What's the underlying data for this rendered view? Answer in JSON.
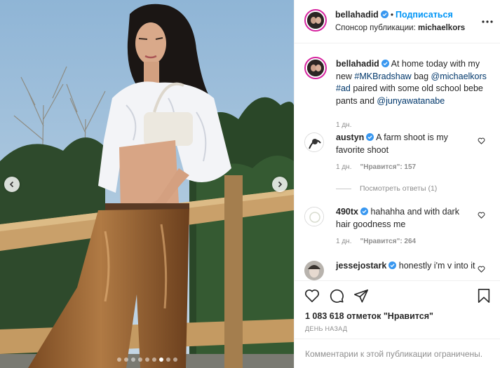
{
  "post": {
    "username": "bellahadid",
    "follow_label": "Подписаться",
    "sponsor_prefix": "Спонсор публикации:",
    "sponsor_name": "michaelkors",
    "separator": "•"
  },
  "caption": {
    "username": "bellahadid",
    "text_1": "At home today with my new",
    "link_hashtag": "#MKBradshaw",
    "text_2": "bag",
    "link_brand": "@michaelkors",
    "link_ad": "#ad",
    "text_3": "paired with some old school bebe pants and",
    "link_user": "@junyawatanabe",
    "time": "1 дн."
  },
  "comments": [
    {
      "username": "austyn",
      "text": "A farm shoot is my favorite shoot",
      "time": "1 дн.",
      "likes": "\"Нравится\": 157",
      "replies_label": "Посмотреть ответы (1)"
    },
    {
      "username": "490tx",
      "text": "hahahha and with dark hair goodness me",
      "time": "1 дн.",
      "likes": "\"Нравится\": 264"
    },
    {
      "username": "jessejostark",
      "text": "honestly i'm v into it"
    }
  ],
  "stats": {
    "likes_line": "1 083 618 отметок \"Нравится\"",
    "date": "ДЕНЬ НАЗАД"
  },
  "footer": {
    "comments_disabled": "Комментарии к этой публикации ограничены."
  },
  "carousel": {
    "slide_count": 9,
    "active_index": 6
  },
  "colors": {
    "accent_blue": "#0095f6",
    "link_blue": "#00376b",
    "verified_blue": "#3897f0",
    "secondary_text": "#8e8e8e",
    "story_ring": "#d6249f"
  },
  "icons": [
    "verified-icon",
    "more-options-icon",
    "heart-icon",
    "comment-icon",
    "share-icon",
    "bookmark-icon",
    "chevron-left-icon",
    "chevron-right-icon"
  ]
}
